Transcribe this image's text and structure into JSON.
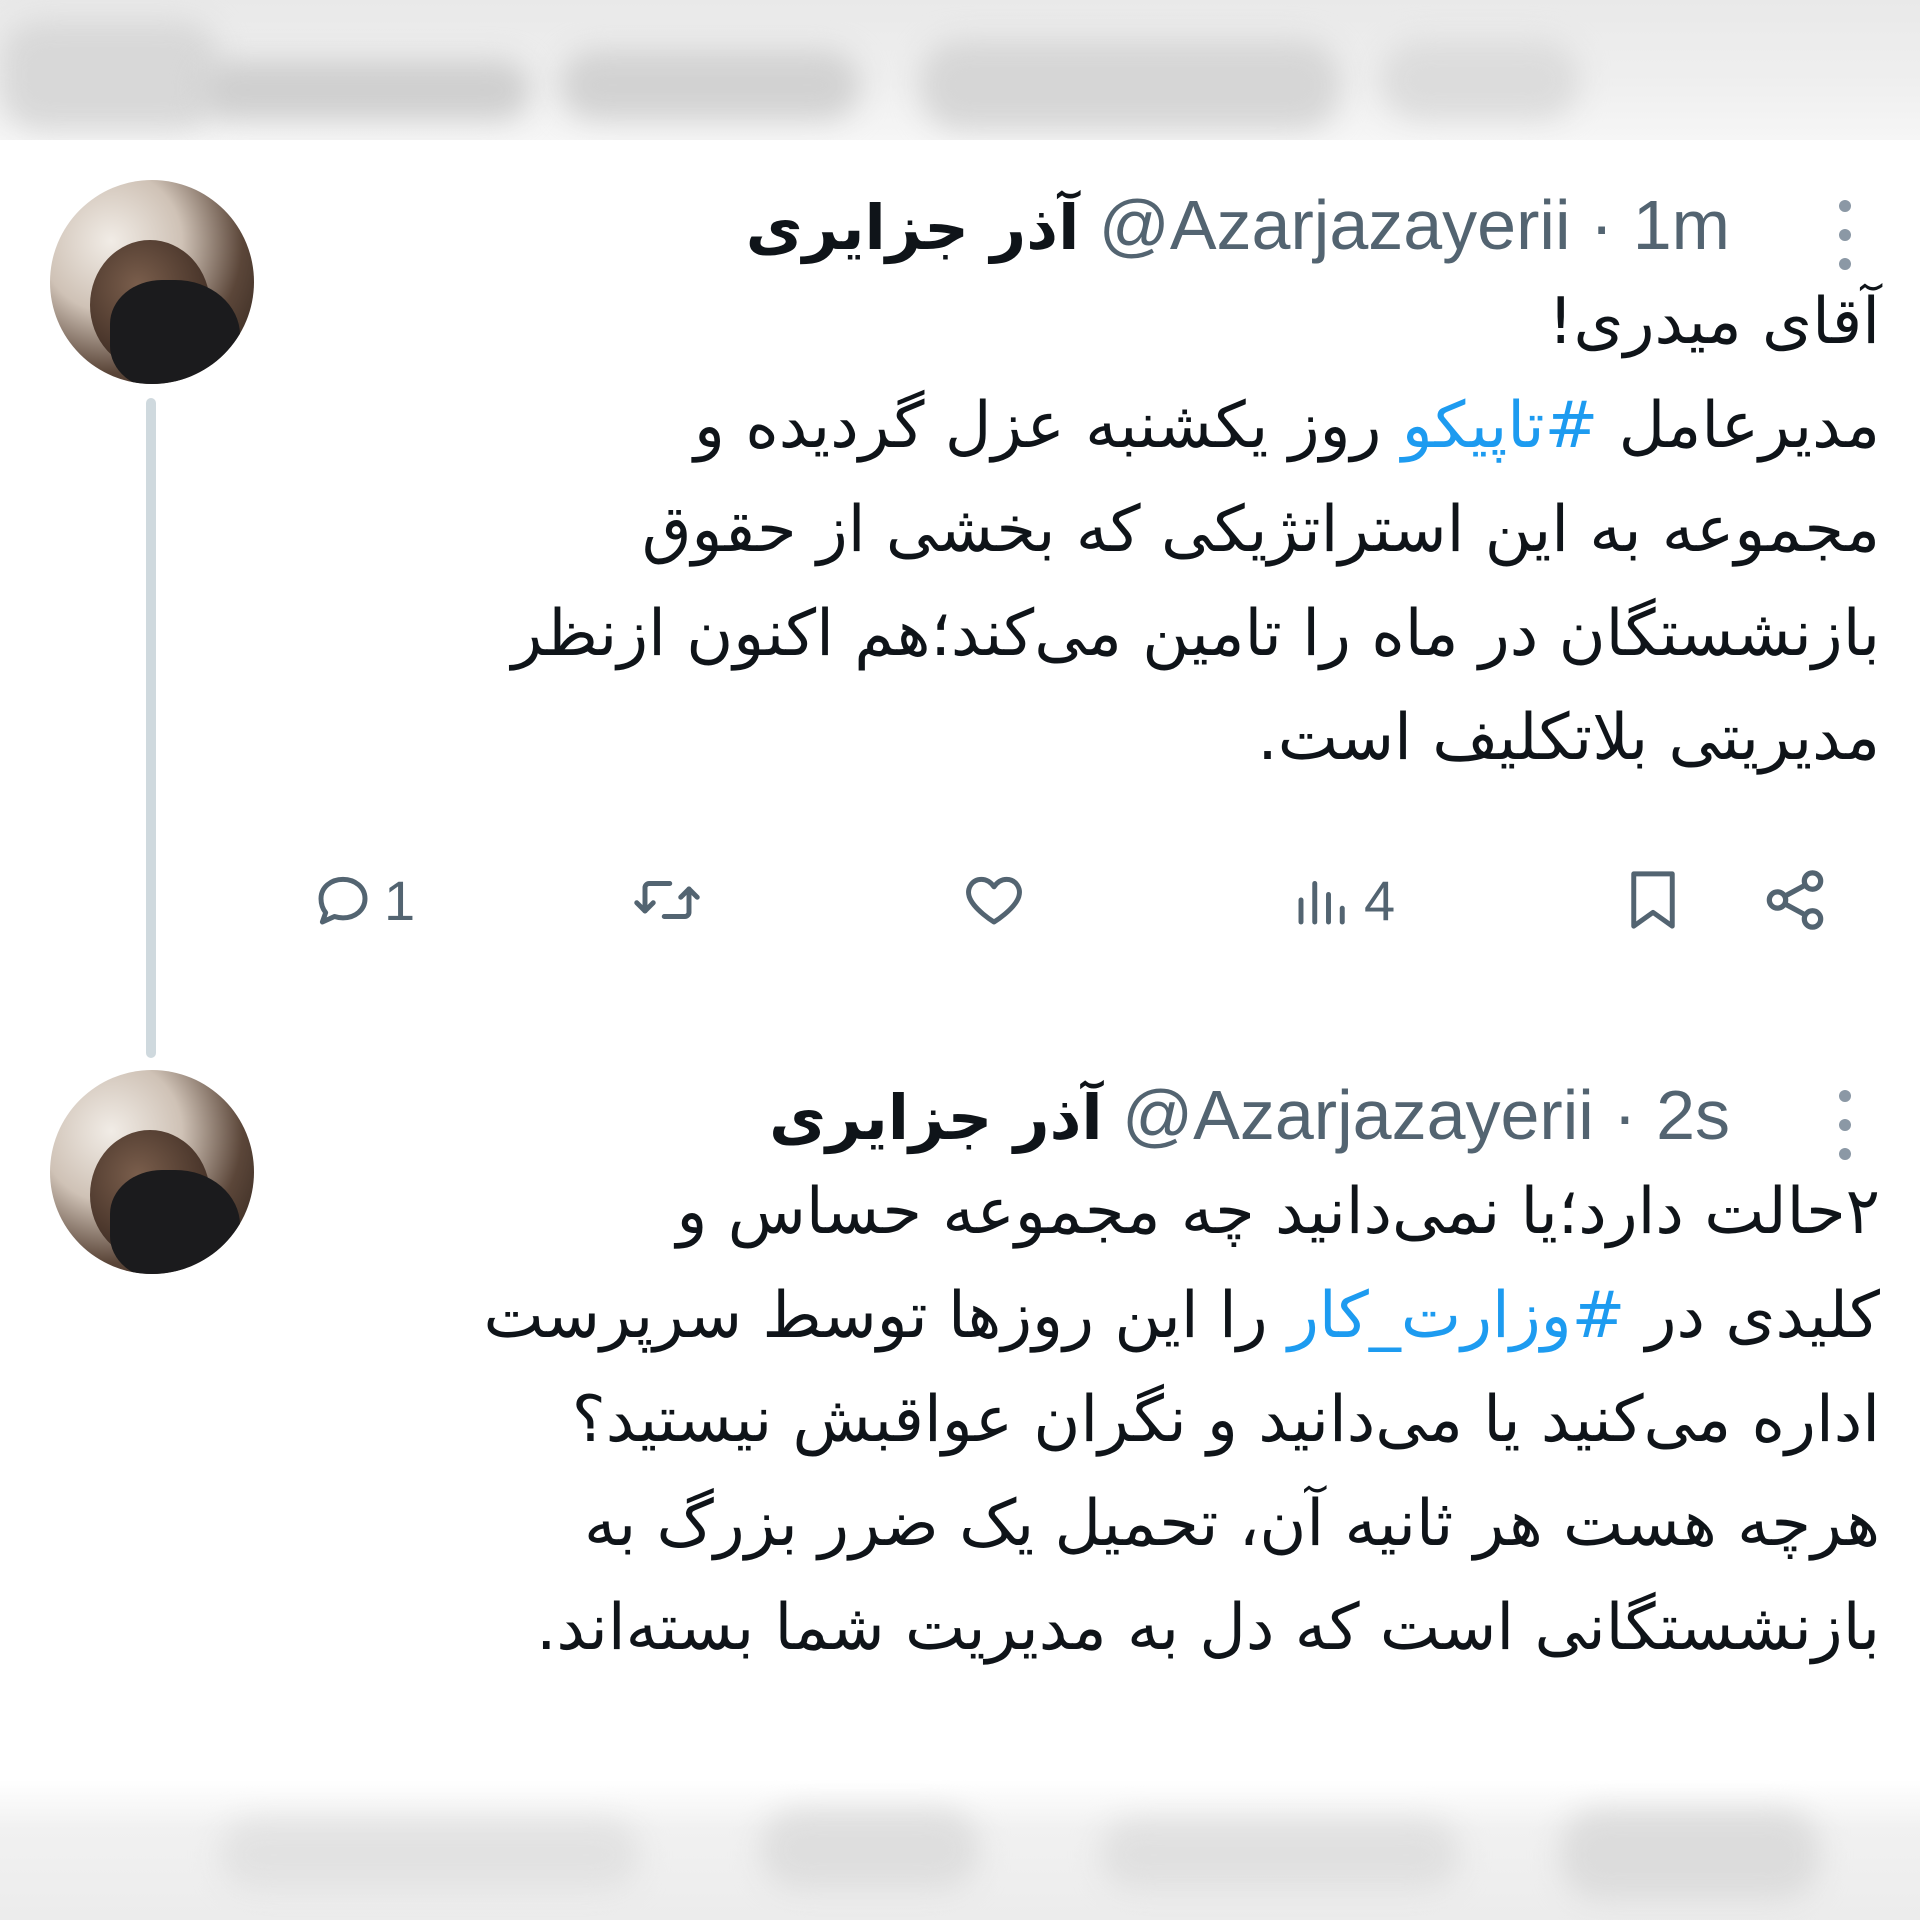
{
  "tweets": [
    {
      "display_name": "آذر جزایری",
      "handle": "@Azarjazayerii",
      "time": "1m",
      "lines": [
        [
          "آقای میدری!"
        ],
        [
          "مدیرعامل ",
          "#تاپیکو",
          " روز یکشنبه عزل گردیده و"
        ],
        [
          "مجموعه به این استراتژیکی که بخشی از حقوق"
        ],
        [
          "بازنشستگان در ماه را تامین می‌کند؛هم اکنون ازنظر"
        ],
        [
          "مدیریتی بلاتکلیف است."
        ]
      ],
      "hashtags": [
        "#تاپیکو"
      ],
      "reply_count": "1",
      "views_count": "4"
    },
    {
      "display_name": "آذر جزایری",
      "handle": "@Azarjazayerii",
      "time": "2s",
      "lines": [
        [
          "۲حالت دارد؛یا نمی‌دانید چه مجموعه حساس و"
        ],
        [
          "کلیدی در ",
          "#وزارت_کار",
          " را این روزها توسط سرپرست"
        ],
        [
          "اداره می‌کنید یا می‌دانید و نگران عواقبش نیستید؟"
        ],
        [
          "هرچه هست هر ثانیه آن، تحمیل یک ضرر بزرگ به"
        ],
        [
          "بازنشستگانی است که دل به مدیریت شما بسته‌اند."
        ]
      ],
      "hashtags": [
        "#وزارت_کار"
      ]
    }
  ],
  "icons": {
    "more": "more-vertical-icon",
    "reply": "reply-icon",
    "retweet": "retweet-icon",
    "like": "heart-icon",
    "views": "views-icon",
    "bookmark": "bookmark-icon",
    "share": "share-icon"
  },
  "colors": {
    "text": "#0f1419",
    "secondary": "#536471",
    "hashtag": "#1d9bf0",
    "thread_line": "#cfd9de"
  }
}
